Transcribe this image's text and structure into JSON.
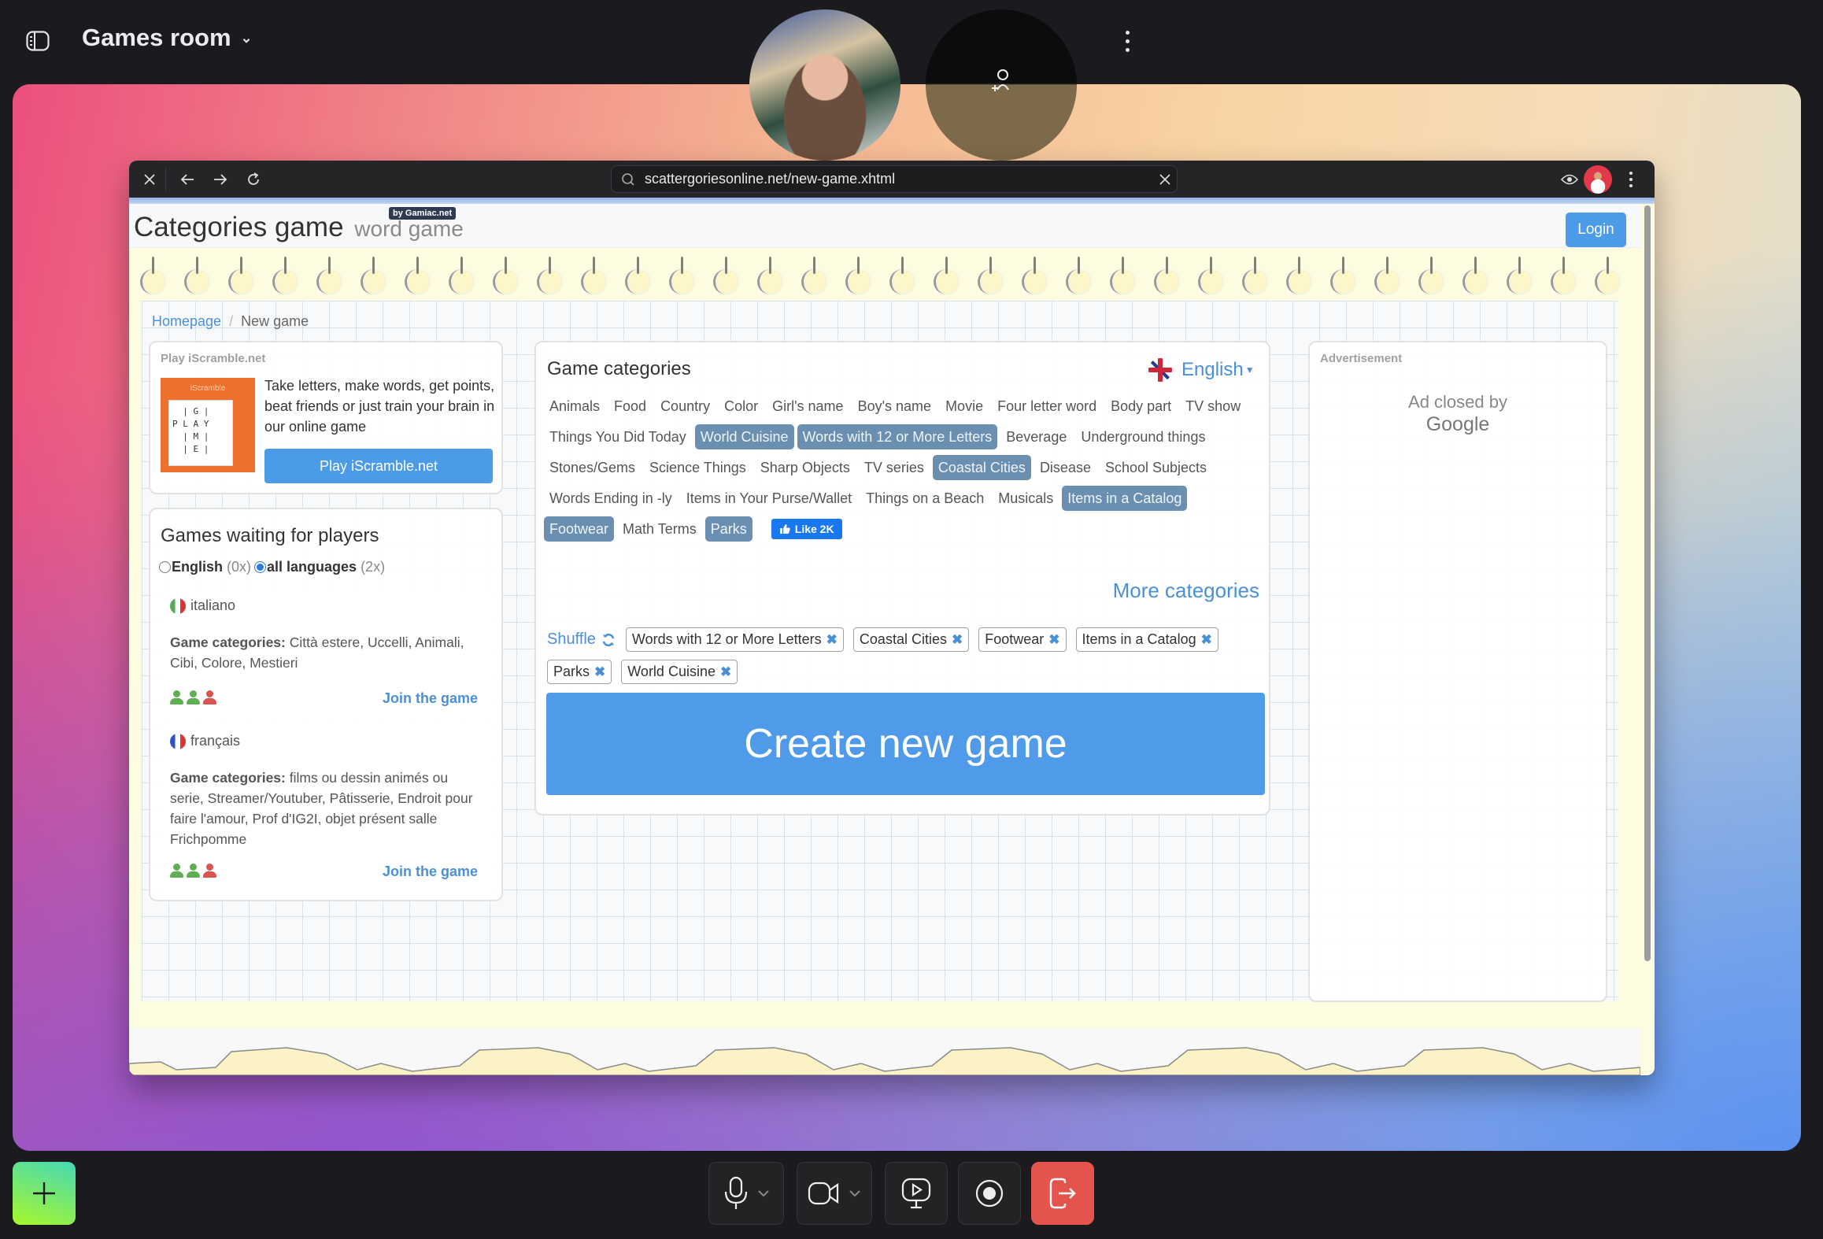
{
  "topbar": {
    "room_title": "Games room",
    "sidebar_toggle_icon": "sidebar-icon",
    "more_icon": "kebab-icon"
  },
  "participants": [
    {
      "name": "participant-video",
      "type": "video"
    },
    {
      "name": "invite-participant",
      "icon": "add-person-icon"
    }
  ],
  "browser": {
    "url": "scattergoriesonline.net/new-game.xhtml",
    "buttons": [
      "close",
      "back",
      "forward",
      "reload"
    ],
    "right_icons": [
      "eye-icon",
      "profile-avatar",
      "kebab-icon"
    ]
  },
  "site": {
    "title": "Categories game",
    "subtitle": "word game",
    "badge": "by Gamiac.net",
    "login_label": "Login",
    "breadcrumb": {
      "home": "Homepage",
      "separator": "/",
      "current": "New game"
    }
  },
  "iscramble": {
    "label": "Play iScramble.net",
    "image_brand": "iScramble",
    "image_grid": "  | G |\nP L A Y\n  | M |\n  | E |",
    "text": "Take letters, make words, get points, beat friends or just train your brain in our online game",
    "button_label": "Play iScramble.net"
  },
  "waiting": {
    "title": "Games waiting for players",
    "filter": {
      "option_english": "English",
      "count_english": "(0x)",
      "option_all": "all languages",
      "count_all": "(2x)",
      "selected": "all languages"
    },
    "games": [
      {
        "language": "italiano",
        "categories_label": "Game categories:",
        "categories": "Città estere, Uccelli, Animali, Cibi, Colore, Mestieri",
        "players": [
          "joined",
          "joined",
          "open"
        ],
        "join_label": "Join the game"
      },
      {
        "language": "français",
        "categories_label": "Game categories:",
        "categories": "films ou dessin animés ou serie, Streamer/Youtuber, Pâtisserie, Endroit pour faire l'amour, Prof d'IG2I, objet présent salle Frichpomme",
        "players": [
          "joined",
          "joined",
          "open"
        ],
        "join_label": "Join the game"
      }
    ]
  },
  "categories_panel": {
    "title": "Game categories",
    "language": "English",
    "categories": [
      {
        "label": "Animals",
        "selected": false
      },
      {
        "label": "Food",
        "selected": false
      },
      {
        "label": "Country",
        "selected": false
      },
      {
        "label": "Color",
        "selected": false
      },
      {
        "label": "Girl's name",
        "selected": false
      },
      {
        "label": "Boy's name",
        "selected": false
      },
      {
        "label": "Movie",
        "selected": false
      },
      {
        "label": "Four letter word",
        "selected": false
      },
      {
        "label": "Body part",
        "selected": false
      },
      {
        "label": "TV show",
        "selected": false
      },
      {
        "label": "Things You Did Today",
        "selected": false
      },
      {
        "label": "World Cuisine",
        "selected": true
      },
      {
        "label": "Words with 12 or More Letters",
        "selected": true
      },
      {
        "label": "Beverage",
        "selected": false
      },
      {
        "label": "Underground things",
        "selected": false
      },
      {
        "label": "Stones/Gems",
        "selected": false
      },
      {
        "label": "Science Things",
        "selected": false
      },
      {
        "label": "Sharp Objects",
        "selected": false
      },
      {
        "label": "TV series",
        "selected": false
      },
      {
        "label": "Coastal Cities",
        "selected": true
      },
      {
        "label": "Disease",
        "selected": false
      },
      {
        "label": "School Subjects",
        "selected": false
      },
      {
        "label": "Words Ending in -ly",
        "selected": false
      },
      {
        "label": "Items in Your Purse/Wallet",
        "selected": false
      },
      {
        "label": "Things on a Beach",
        "selected": false
      },
      {
        "label": "Musicals",
        "selected": false
      },
      {
        "label": "Items in a Catalog",
        "selected": true
      },
      {
        "label": "Footwear",
        "selected": true
      },
      {
        "label": "Math Terms",
        "selected": false
      },
      {
        "label": "Parks",
        "selected": true
      }
    ],
    "fb_like_label": "Like 2K",
    "more_label": "More categories",
    "shuffle_label": "Shuffle",
    "chosen": [
      "Words with 12 or More Letters",
      "Coastal Cities",
      "Footwear",
      "Items in a Catalog",
      "Parks",
      "World Cuisine"
    ],
    "create_label": "Create new game"
  },
  "ad": {
    "label": "Advertisement",
    "closed_text": "Ad closed by",
    "closed_brand": "Google"
  },
  "controls": {
    "add_icon": "plus-icon",
    "buttons": [
      "microphone",
      "camera",
      "screen-share",
      "record",
      "leave"
    ],
    "colors": {
      "leave": "#e5544c",
      "add_start": "#46d9b6",
      "add_end": "#a8f72a"
    }
  }
}
